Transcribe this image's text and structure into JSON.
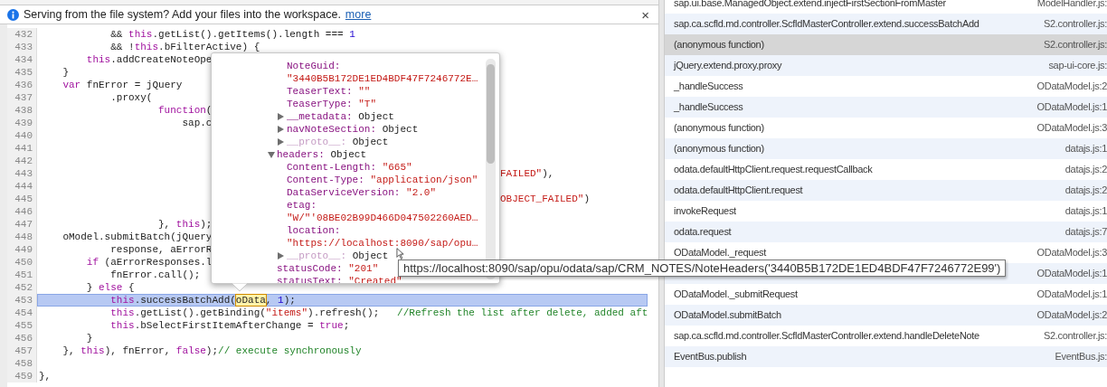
{
  "infobar": {
    "message": "Serving from the file system? Add your files into the workspace.",
    "link": "more",
    "close": "×"
  },
  "editor": {
    "lines": [
      {
        "number": "432",
        "current": false,
        "tokens": [
          "            && ",
          {
            "kind": "keyword",
            "text": "this"
          },
          ".getList().getItems().length === ",
          {
            "kind": "number",
            "text": "1"
          }
        ]
      },
      {
        "number": "433",
        "current": false,
        "tokens": [
          "            && !",
          {
            "kind": "keyword",
            "text": "this"
          },
          ".bFilterActive) {"
        ]
      },
      {
        "number": "434",
        "current": false,
        "tokens": [
          {
            "kind": "keyword",
            "text": "        this"
          },
          ".addCreateNoteOpe"
        ]
      },
      {
        "number": "435",
        "current": false,
        "tokens": [
          "    }"
        ]
      },
      {
        "number": "436",
        "current": false,
        "tokens": [
          {
            "kind": "keyword",
            "text": "    var"
          },
          " fnError = jQuery"
        ]
      },
      {
        "number": "437",
        "current": false,
        "tokens": [
          "            .proxy("
        ]
      },
      {
        "number": "438",
        "current": false,
        "tokens": [
          {
            "kind": "keyword",
            "text": "                    function"
          },
          "("
        ]
      },
      {
        "number": "439",
        "current": false,
        "tokens": [
          "                        sap.c"
        ]
      },
      {
        "number": "440",
        "current": false
      },
      {
        "number": "441",
        "current": false
      },
      {
        "number": "442",
        "current": false
      },
      {
        "number": "443",
        "current": false,
        "right": [
          {
            "kind": "string",
            "text": "FAILED\""
          },
          "),"
        ]
      },
      {
        "number": "444",
        "current": false
      },
      {
        "number": "445",
        "current": false,
        "right": [
          {
            "kind": "string",
            "text": "OBJECT_FAILED\""
          },
          ")"
        ]
      },
      {
        "number": "446",
        "current": false
      },
      {
        "number": "447",
        "current": false,
        "tokens": [
          "                    }, ",
          {
            "kind": "keyword",
            "text": "this"
          },
          ");"
        ]
      },
      {
        "number": "448",
        "current": false,
        "tokens": [
          "    oModel.submitBatch(jQuery"
        ]
      },
      {
        "number": "449",
        "current": false,
        "tokens": [
          "            response, aErrorR"
        ]
      },
      {
        "number": "450",
        "current": false,
        "tokens": [
          {
            "kind": "keyword",
            "text": "        if"
          },
          " (aErrorResponses.l"
        ]
      },
      {
        "number": "451",
        "current": false,
        "tokens": [
          "            fnError.call();"
        ]
      },
      {
        "number": "452",
        "current": false,
        "tokens": [
          "        } ",
          {
            "kind": "keyword",
            "text": "else"
          },
          " {"
        ]
      },
      {
        "number": "453",
        "current": true,
        "tokens": [
          {
            "kind": "keyword",
            "text": "            this"
          },
          ".successBatchAdd(",
          {
            "kind": "hover",
            "text": "oData"
          },
          ", ",
          {
            "kind": "number",
            "text": "1"
          },
          ");"
        ]
      },
      {
        "number": "454",
        "current": false,
        "tokens": [
          {
            "kind": "keyword",
            "text": "            this"
          },
          ".getList().getBinding(",
          {
            "kind": "string",
            "text": "\"items\""
          },
          ").refresh();   ",
          {
            "kind": "comment",
            "text": "//Refresh the list after delete, added aft"
          }
        ]
      },
      {
        "number": "455",
        "current": false,
        "tokens": [
          {
            "kind": "keyword",
            "text": "            this"
          },
          ".bSelectFirstItemAfterChange = ",
          {
            "kind": "keyword",
            "text": "true"
          },
          ";"
        ]
      },
      {
        "number": "456",
        "current": false,
        "tokens": [
          "        }"
        ]
      },
      {
        "number": "457",
        "current": false,
        "tokens": [
          "    }, ",
          {
            "kind": "keyword",
            "text": "this"
          },
          "), fnError, ",
          {
            "kind": "keyword",
            "text": "false"
          },
          ");",
          {
            "kind": "comment",
            "text": "// execute synchronously"
          }
        ]
      },
      {
        "number": "458",
        "current": false
      },
      {
        "number": "459",
        "current": false,
        "tokens": [
          "},"
        ]
      }
    ]
  },
  "popover": {
    "nodes": [
      {
        "children": [
          {
            "key": "NoteGuid:",
            "value": "\"3440B5B172DE1ED4BDF47F7246772E…",
            "kind": "string_below",
            "dim": false
          },
          {
            "key": "TeaserText:",
            "value": "\"\"",
            "kind": "string",
            "dim": false
          },
          {
            "key": "TeaserType:",
            "value": "\"T\"",
            "kind": "string",
            "dim": false
          },
          {
            "key": "__metadata:",
            "value": "Object",
            "kind": "object",
            "expanded": false,
            "dim": false
          },
          {
            "key": "navNoteSection:",
            "value": "Object",
            "kind": "object",
            "expanded": false,
            "dim": false
          },
          {
            "key": "__proto__:",
            "value": "Object",
            "kind": "object",
            "expanded": false,
            "dim": true
          }
        ]
      },
      {
        "key": "headers:",
        "value": "Object",
        "kind": "object",
        "expanded": true,
        "dim": false,
        "children": [
          {
            "key": "Content-Length:",
            "value": "\"665\"",
            "kind": "string",
            "dim": false
          },
          {
            "key": "Content-Type:",
            "value": "\"application/json\"",
            "kind": "string",
            "dim": false
          },
          {
            "key": "DataServiceVersion:",
            "value": "\"2.0\"",
            "kind": "string",
            "dim": false
          },
          {
            "key": "etag:",
            "value": "\"W/\"'08BE02B99D466D047502260AED…",
            "kind": "string_below",
            "dim": false
          },
          {
            "key": "location:",
            "value": "\"https://localhost:8090/sap/opu…",
            "kind": "string_below",
            "dim": false
          },
          {
            "key": "__proto__:",
            "value": "Object",
            "kind": "object",
            "expanded": false,
            "dim": true
          }
        ]
      },
      {
        "key": "statusCode:",
        "value": "\"201\"",
        "kind": "string",
        "dim": false
      },
      {
        "key": "statusText:",
        "value": "\"Created\"",
        "kind": "string",
        "dim": false
      }
    ]
  },
  "tooltip": {
    "text": "https://localhost:8090/sap/opu/odata/sap/CRM_NOTES/NoteHeaders('3440B5B172DE1ED4BDF47F7246772E99')"
  },
  "call_stack": {
    "frames": [
      {
        "function": "sap.ui.base.ManagedObject.extend.injectFirstSectionFromMaster",
        "file": "ModelHandler.js:",
        "selected": false
      },
      {
        "function": "sap.ca.scfld.md.controller.ScfldMasterController.extend.successBatchAdd",
        "file": "S2.controller.js:",
        "selected": false
      },
      {
        "function": "(anonymous function)",
        "file": "S2.controller.js:",
        "selected": true
      },
      {
        "function": "jQuery.extend.proxy.proxy",
        "file": "sap-ui-core.js:",
        "selected": false
      },
      {
        "function": "_handleSuccess",
        "file": "ODataModel.js:2",
        "selected": false
      },
      {
        "function": "_handleSuccess",
        "file": "ODataModel.js:1",
        "selected": false
      },
      {
        "function": "(anonymous function)",
        "file": "ODataModel.js:3",
        "selected": false
      },
      {
        "function": "(anonymous function)",
        "file": "datajs.js:1",
        "selected": false
      },
      {
        "function": "odata.defaultHttpClient.request.requestCallback",
        "file": "datajs.js:2",
        "selected": false
      },
      {
        "function": "odata.defaultHttpClient.request",
        "file": "datajs.js:2",
        "selected": false
      },
      {
        "function": "invokeRequest",
        "file": "datajs.js:1",
        "selected": false
      },
      {
        "function": "odata.request",
        "file": "datajs.js:7",
        "selected": false
      },
      {
        "function": "ODataModel._request",
        "file": "ODataModel.js:3",
        "selected": false
      },
      {
        "file": "ODataModel.js:1",
        "selected": false
      },
      {
        "function": "ODataModel._submitRequest",
        "file": "ODataModel.js:1",
        "selected": false
      },
      {
        "function": "ODataModel.submitBatch",
        "file": "ODataModel.js:2",
        "selected": false
      },
      {
        "function": "sap.ca.scfld.md.controller.ScfldMasterController.extend.handleDeleteNote",
        "file": "S2.controller.js:",
        "selected": false
      },
      {
        "function": "EventBus.publish",
        "file": "EventBus.js:",
        "selected": false
      }
    ]
  }
}
